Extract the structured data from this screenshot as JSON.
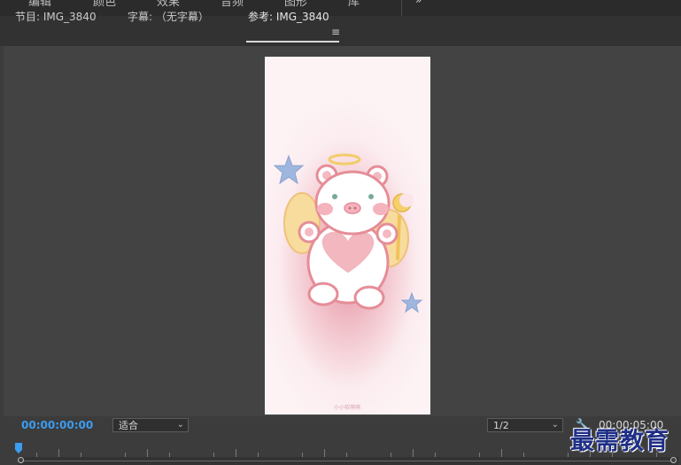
{
  "workspace_tabs": [
    "编辑",
    "颜色",
    "效果",
    "音频",
    "图形",
    "库"
  ],
  "workspace_more": "»",
  "panel_tabs": {
    "program": "节目: IMG_3840",
    "captions": "字幕: （无字幕）",
    "reference": "参考: IMG_3840",
    "menu_icon": "≡"
  },
  "frame": {
    "caption": "小小软萌萌",
    "colors": {
      "bg": "#fbeaf0",
      "glow": "#e38fa0",
      "bear_outline": "#e58d98",
      "heart": "#f2b7bf",
      "wings": "#f8dc9e",
      "star": "#9fb6de",
      "halo": "#f2cc6a"
    }
  },
  "controls": {
    "timecode": "00:00:00:00",
    "zoom": "适合",
    "resolution": "1/2",
    "duration": "00:00:05:00",
    "accent": "#3b9cf0"
  },
  "watermark": "最需教育"
}
